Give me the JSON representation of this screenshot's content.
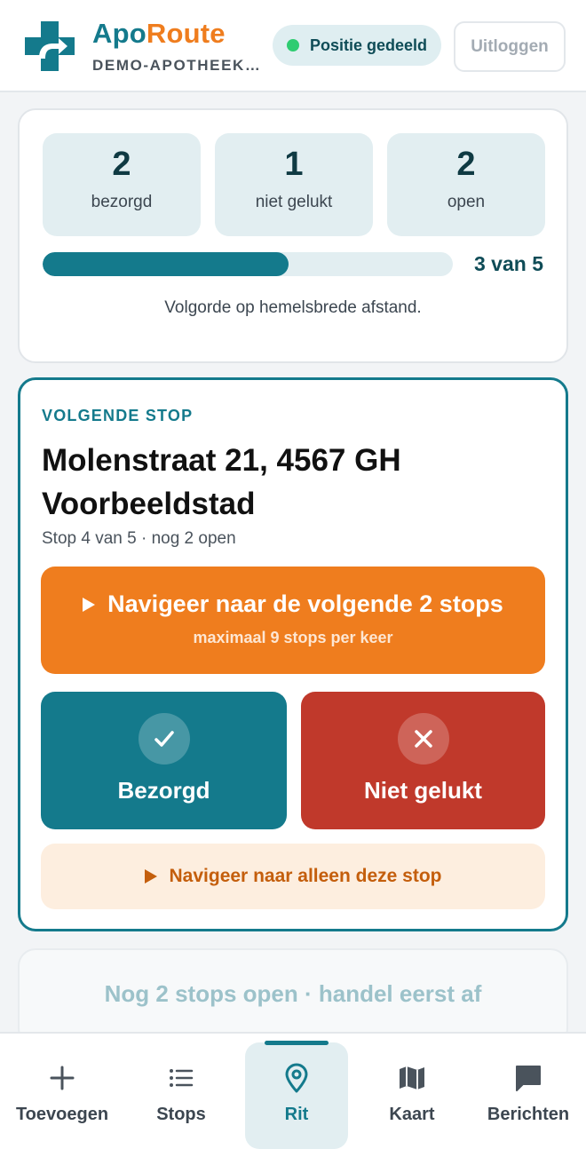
{
  "header": {
    "brand_part1": "Apo",
    "brand_part2": "Route",
    "pharmacy": "DEMO-APOTHEEK…",
    "position_badge": "Positie gedeeld",
    "logout_label": "Uitloggen"
  },
  "stats": {
    "items": [
      {
        "value": "2",
        "label": "bezorgd"
      },
      {
        "value": "1",
        "label": "niet gelukt"
      },
      {
        "value": "2",
        "label": "open"
      }
    ],
    "progress_fraction": 0.6,
    "progress_text": "3 van 5",
    "order_note": "Volgorde op hemelsbrede afstand."
  },
  "next_stop": {
    "section_label": "VOLGENDE STOP",
    "address": "Molenstraat 21, 4567 GH Voorbeeldstad",
    "meta": "Stop 4 van 5 · nog 2 open",
    "nav_multi_label": "Navigeer naar de volgende 2 stops",
    "nav_multi_sub": "maximaal 9 stops per keer",
    "delivered_label": "Bezorgd",
    "failed_label": "Niet gelukt",
    "nav_single_label": "Navigeer naar alleen deze stop"
  },
  "hint": {
    "text": "Nog 2 stops open · handel eerst af"
  },
  "bottom_nav": {
    "items": [
      {
        "label": "Toevoegen",
        "icon": "plus-icon"
      },
      {
        "label": "Stops",
        "icon": "list-icon"
      },
      {
        "label": "Rit",
        "icon": "location-pin-icon"
      },
      {
        "label": "Kaart",
        "icon": "map-icon"
      },
      {
        "label": "Berichten",
        "icon": "message-icon"
      }
    ],
    "active": "Rit"
  },
  "colors": {
    "primary": "#147a8c",
    "accent": "#ef7d1e",
    "danger": "#c0392b",
    "success_dot": "#2ecc71"
  }
}
